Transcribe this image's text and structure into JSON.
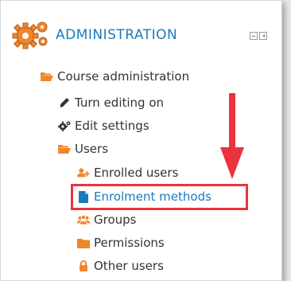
{
  "header": {
    "title": "ADMINISTRATION"
  },
  "tree": {
    "course_admin": "Course administration",
    "turn_editing": "Turn editing on",
    "edit_settings": "Edit settings",
    "users": "Users",
    "enrolled_users": "Enrolled users",
    "enrolment_methods": "Enrolment methods",
    "groups": "Groups",
    "permissions": "Permissions",
    "other_users": "Other users"
  },
  "colors": {
    "link": "#1a7bbd",
    "icon_orange": "#f0862b",
    "highlight": "#e8343d"
  },
  "icons": [
    "gears-icon",
    "folder-open-icon",
    "pencil-icon",
    "gear-icon",
    "user-add-icon",
    "file-icon",
    "users-icon",
    "folder-icon",
    "lock-icon"
  ]
}
